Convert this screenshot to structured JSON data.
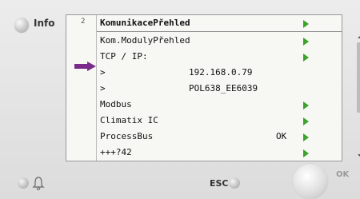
{
  "panel": {
    "info_label": "Info",
    "esc_label": "ESC",
    "ok_label": "OK"
  },
  "screen": {
    "row_number": "2",
    "header": "KomunikacePřehled",
    "rows": [
      {
        "label": "Kom.ModulyPřehled",
        "value": "",
        "status": "",
        "has_arrow": true
      },
      {
        "label": "TCP / IP:",
        "value": "",
        "status": "",
        "has_arrow": true
      },
      {
        "label": ">",
        "value": "192.168.0.79",
        "status": "",
        "has_arrow": false
      },
      {
        "label": ">",
        "value": "POL638_EE6039",
        "status": "",
        "has_arrow": false
      },
      {
        "label": "Modbus",
        "value": "",
        "status": "",
        "has_arrow": true
      },
      {
        "label": "Climatix IC",
        "value": "",
        "status": "",
        "has_arrow": true
      },
      {
        "label": "ProcessBus",
        "value": "",
        "status": "OK",
        "has_arrow": true
      },
      {
        "label": "+++?42",
        "value": "",
        "status": "",
        "has_arrow": true
      }
    ]
  },
  "colors": {
    "arrow_accent": "#7a2a8a",
    "nav_triangle": "#3ca22b"
  },
  "icons": {
    "info_button": "round-button",
    "alarm": "bell-icon",
    "esc_button": "round-button",
    "ok_button": "rotary-knob"
  }
}
